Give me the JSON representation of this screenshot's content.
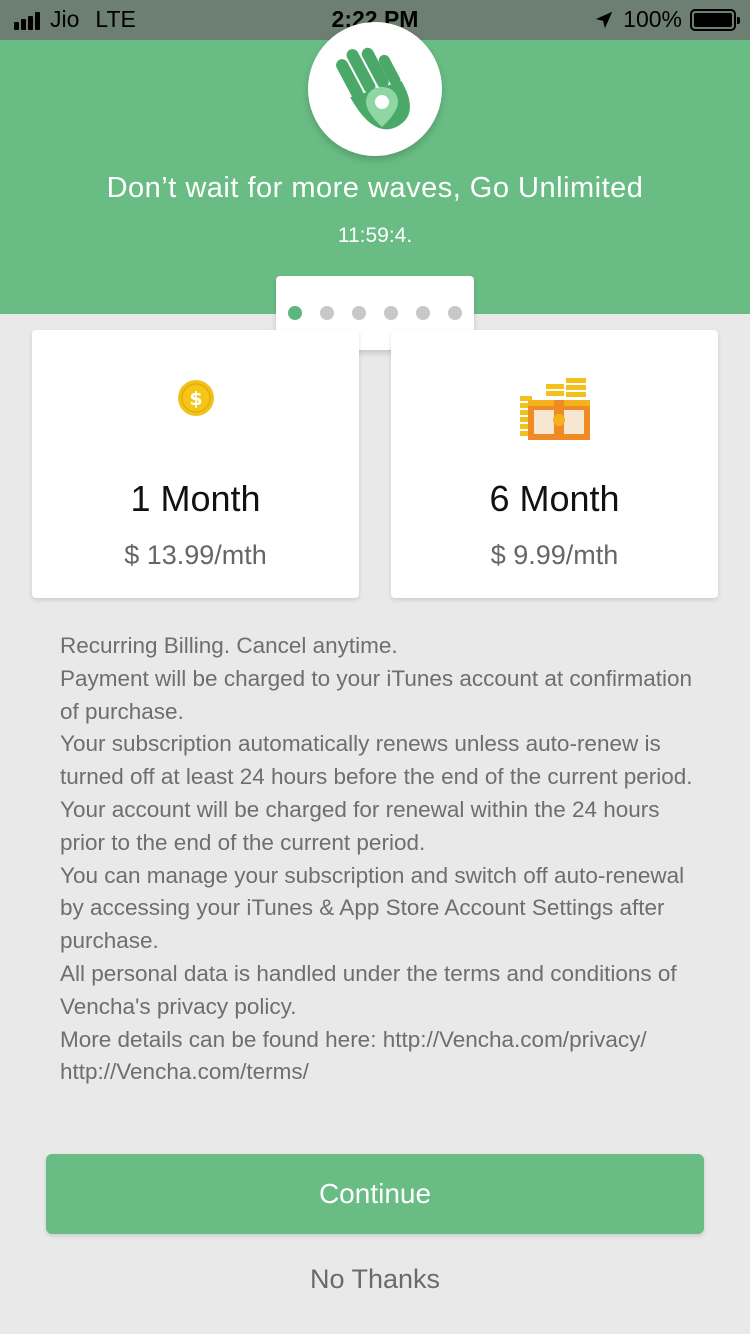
{
  "status_bar": {
    "carrier": "Jio",
    "network": "LTE",
    "time": "2:22 PM",
    "battery": "100%",
    "icons": [
      "signal-icon",
      "location-arrow-icon",
      "battery-icon"
    ]
  },
  "header": {
    "logo_icon": "hand-location-pin-icon",
    "headline": "Don’t wait for more waves, Go Unlimited",
    "timer": "11:59:4."
  },
  "pager": {
    "count": 6,
    "active_index": 0
  },
  "plans": [
    {
      "icon": "dollar-coin-icon",
      "title": "1 Month",
      "price": "$ 13.99/mth"
    },
    {
      "icon": "treasure-chest-icon",
      "title": "6 Month",
      "price": "$ 9.99/mth"
    }
  ],
  "terms": [
    "Recurring Billing. Cancel anytime.",
    "Payment will be charged to your iTunes account at confirmation of purchase.",
    "Your subscription automatically renews unless auto-renew is turned off at least 24 hours before the end of the current period.",
    "Your account will be charged for renewal within the 24 hours prior to the end of the current period.",
    "You can manage your subscription and switch off auto-renewal by accessing your iTunes & App Store Account Settings after purchase.",
    "All personal data is handled under the terms and conditions of Vencha's privacy policy.",
    "More details can be found here: http://Vencha.com/privacy/ http://Vencha.com/terms/"
  ],
  "actions": {
    "continue_label": "Continue",
    "no_thanks_label": "No Thanks"
  },
  "colors": {
    "brand_green": "#69bd84",
    "coin_gold": "#f2c21b",
    "chest_orange": "#f08a24"
  }
}
